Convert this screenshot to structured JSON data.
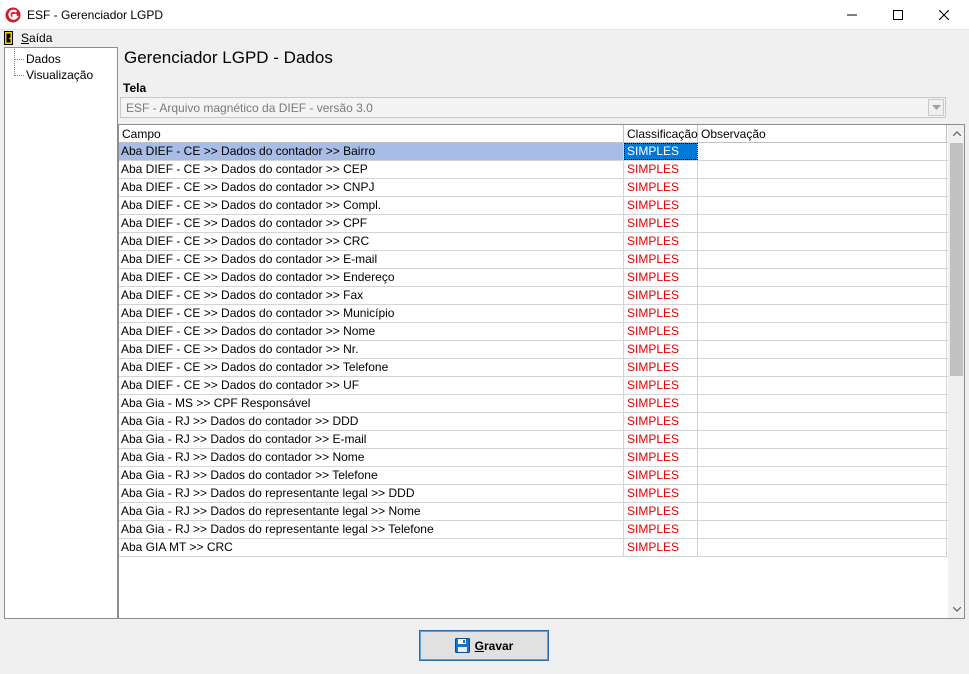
{
  "window": {
    "title": "ESF - Gerenciador LGPD"
  },
  "menu": {
    "exit_label": "Saída",
    "exit_hotkey": "S",
    "exit_rest": "aída"
  },
  "tree": {
    "items": [
      {
        "label": "Dados"
      },
      {
        "label": "Visualização"
      }
    ]
  },
  "main": {
    "title": "Gerenciador LGPD - Dados",
    "tela_label": "Tela",
    "tela_value": "ESF - Arquivo magnético da DIEF - versão 3.0"
  },
  "grid": {
    "columns": [
      "Campo",
      "Classificação",
      "Observação"
    ],
    "rows": [
      {
        "campo": "Aba DIEF - CE >> Dados do contador >> Bairro",
        "classificacao": "SIMPLES",
        "observacao": ""
      },
      {
        "campo": "Aba DIEF - CE >> Dados do contador >> CEP",
        "classificacao": "SIMPLES",
        "observacao": ""
      },
      {
        "campo": "Aba DIEF - CE >> Dados do contador >> CNPJ",
        "classificacao": "SIMPLES",
        "observacao": ""
      },
      {
        "campo": "Aba DIEF - CE >> Dados do contador >> Compl.",
        "classificacao": "SIMPLES",
        "observacao": ""
      },
      {
        "campo": "Aba DIEF - CE >> Dados do contador >> CPF",
        "classificacao": "SIMPLES",
        "observacao": ""
      },
      {
        "campo": "Aba DIEF - CE >> Dados do contador >> CRC",
        "classificacao": "SIMPLES",
        "observacao": ""
      },
      {
        "campo": "Aba DIEF - CE >> Dados do contador >> E-mail",
        "classificacao": "SIMPLES",
        "observacao": ""
      },
      {
        "campo": "Aba DIEF - CE >> Dados do contador >> Endereço",
        "classificacao": "SIMPLES",
        "observacao": ""
      },
      {
        "campo": "Aba DIEF - CE >> Dados do contador >> Fax",
        "classificacao": "SIMPLES",
        "observacao": ""
      },
      {
        "campo": "Aba DIEF - CE >> Dados do contador >> Município",
        "classificacao": "SIMPLES",
        "observacao": ""
      },
      {
        "campo": "Aba DIEF - CE >> Dados do contador >> Nome",
        "classificacao": "SIMPLES",
        "observacao": ""
      },
      {
        "campo": "Aba DIEF - CE >> Dados do contador >> Nr.",
        "classificacao": "SIMPLES",
        "observacao": ""
      },
      {
        "campo": "Aba DIEF - CE >> Dados do contador >> Telefone",
        "classificacao": "SIMPLES",
        "observacao": ""
      },
      {
        "campo": "Aba DIEF - CE >> Dados do contador >> UF",
        "classificacao": "SIMPLES",
        "observacao": ""
      },
      {
        "campo": "Aba Gia - MS >> CPF Responsável",
        "classificacao": "SIMPLES",
        "observacao": ""
      },
      {
        "campo": "Aba Gia - RJ >> Dados do contador >> DDD",
        "classificacao": "SIMPLES",
        "observacao": ""
      },
      {
        "campo": "Aba Gia - RJ >> Dados do contador >> E-mail",
        "classificacao": "SIMPLES",
        "observacao": ""
      },
      {
        "campo": "Aba Gia - RJ >> Dados do contador >> Nome",
        "classificacao": "SIMPLES",
        "observacao": ""
      },
      {
        "campo": "Aba Gia - RJ >> Dados do contador >> Telefone",
        "classificacao": "SIMPLES",
        "observacao": ""
      },
      {
        "campo": "Aba Gia - RJ >> Dados do representante legal >> DDD",
        "classificacao": "SIMPLES",
        "observacao": ""
      },
      {
        "campo": "Aba Gia - RJ >> Dados do representante legal >> Nome",
        "classificacao": "SIMPLES",
        "observacao": ""
      },
      {
        "campo": "Aba Gia - RJ >> Dados do representante legal >> Telefone",
        "classificacao": "SIMPLES",
        "observacao": ""
      },
      {
        "campo": "Aba GIA MT >> CRC",
        "classificacao": "SIMPLES",
        "observacao": ""
      }
    ],
    "selected_row": 0
  },
  "footer": {
    "save_label": "Gravar",
    "save_hotkey": "G",
    "save_rest": "ravar"
  },
  "colors": {
    "selection": "#a7bde6",
    "selected_cell": "#0078d7",
    "classification_text": "#e00000",
    "logo_red": "#d7182a"
  },
  "icons": {
    "app": "esf-logo-icon",
    "exit": "exit-door-icon",
    "save": "floppy-disk-icon"
  }
}
